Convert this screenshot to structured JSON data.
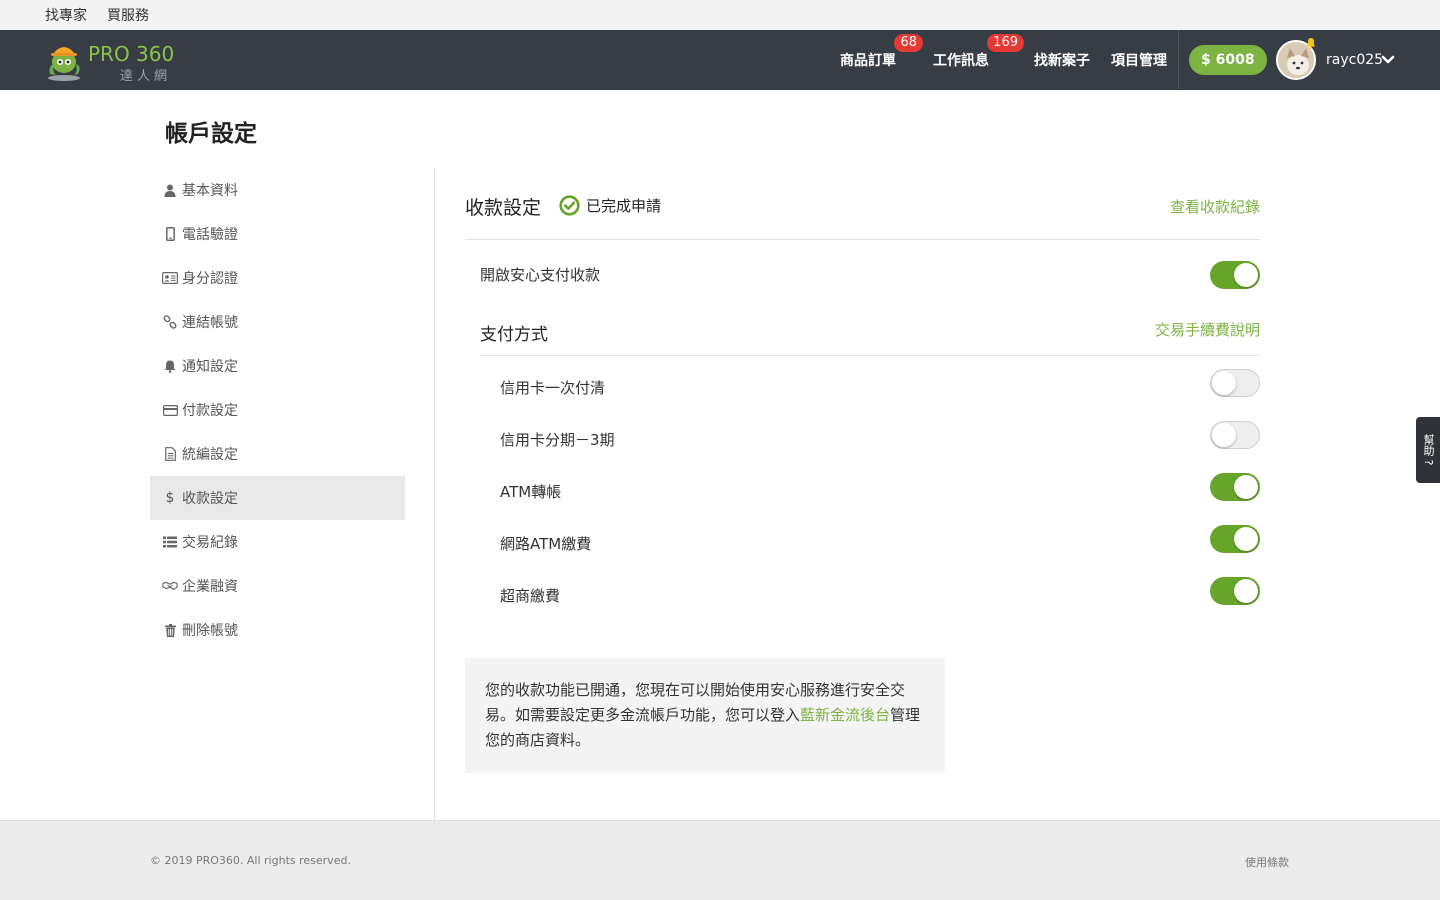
{
  "utilbar": {
    "find_expert": "找專家",
    "buy_service": "買服務"
  },
  "header": {
    "logo_main": "PRO 360",
    "logo_sub": "達人網",
    "nav": [
      {
        "label": "商品訂單",
        "badge": "68"
      },
      {
        "label": "工作訊息",
        "badge": "169"
      },
      {
        "label": "找新案子"
      },
      {
        "label": "項目管理"
      }
    ],
    "wallet": "$ 6008",
    "username": "rayc025"
  },
  "page_title": "帳戶設定",
  "sidebar": {
    "items": [
      {
        "label": "基本資料",
        "icon": "user-icon"
      },
      {
        "label": "電話驗證",
        "icon": "phone-icon"
      },
      {
        "label": "身分認證",
        "icon": "id-card-icon"
      },
      {
        "label": "連結帳號",
        "icon": "link-icon"
      },
      {
        "label": "通知設定",
        "icon": "bell-icon"
      },
      {
        "label": "付款設定",
        "icon": "credit-card-icon"
      },
      {
        "label": "統編設定",
        "icon": "document-icon"
      },
      {
        "label": "收款設定",
        "icon": "dollar-icon",
        "active": true
      },
      {
        "label": "交易紀錄",
        "icon": "list-icon"
      },
      {
        "label": "企業融資",
        "icon": "handshake-icon"
      },
      {
        "label": "刪除帳號",
        "icon": "trash-icon"
      }
    ]
  },
  "main": {
    "title": "收款設定",
    "status": "已完成申請",
    "history_link": "查看收款紀錄",
    "secure_payment": {
      "label": "開啟安心支付收款",
      "enabled": true
    },
    "payment_methods": {
      "title": "支付方式",
      "fee_link": "交易手續費說明",
      "items": [
        {
          "label": "信用卡一次付清",
          "enabled": false
        },
        {
          "label": "信用卡分期－3期",
          "enabled": false
        },
        {
          "label": "ATM轉帳",
          "enabled": true
        },
        {
          "label": "網路ATM繳費",
          "enabled": true
        },
        {
          "label": "超商繳費",
          "enabled": true
        }
      ]
    },
    "notice": {
      "text_before": "您的收款功能已開通，您現在可以開始使用安心服務進行安全交易。如需要設定更多金流帳戶功能，您可以登入",
      "link": "藍新金流後台",
      "text_after": "管理您的商店資料。"
    }
  },
  "footer": {
    "copyright": "© 2019 PRO360. All rights reserved.",
    "terms": "使用條款"
  },
  "help_tab": "幫助 ?",
  "colors": {
    "accent_green": "#7cb342",
    "toggle_on": "#66a52a",
    "header_bg": "#373d44",
    "badge_red": "#e53935"
  }
}
